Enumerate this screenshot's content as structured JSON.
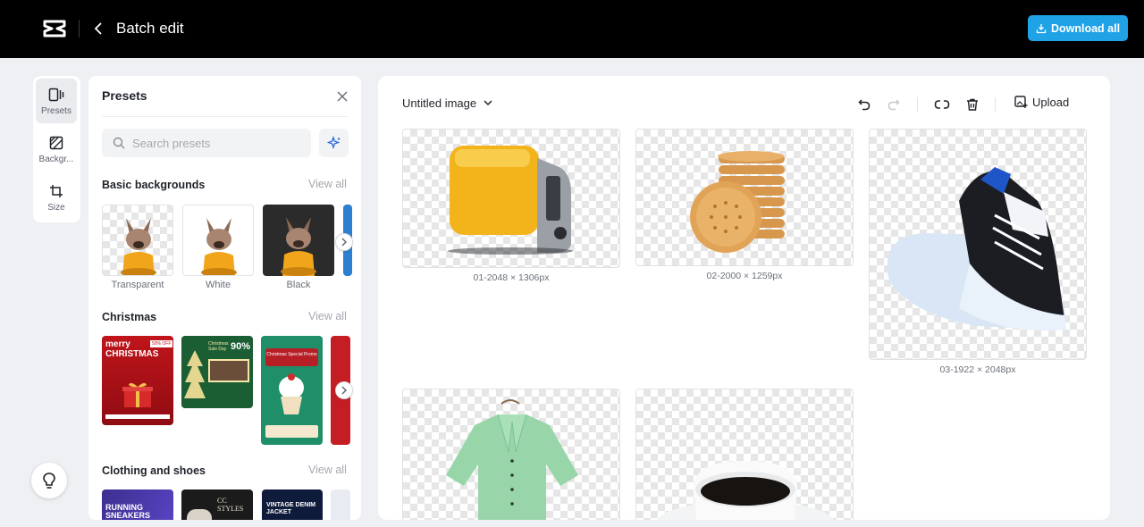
{
  "header": {
    "logo_icon": "capcut-logo",
    "back_icon": "chevron-left-icon",
    "title": "Batch edit",
    "download_label": "Download all",
    "download_color": "#1fa3e6"
  },
  "rail": {
    "items": [
      {
        "label": "Presets",
        "icon": "presets-icon",
        "active": true
      },
      {
        "label": "Backgr...",
        "icon": "background-icon",
        "active": false
      },
      {
        "label": "Size",
        "icon": "crop-icon",
        "active": false
      }
    ],
    "hint_icon": "lightbulb-icon"
  },
  "panel": {
    "title": "Presets",
    "search_placeholder": "Search presets",
    "sections": [
      {
        "title": "Basic backgrounds",
        "view_all": "View all",
        "items": [
          {
            "label": "Transparent"
          },
          {
            "label": "White"
          },
          {
            "label": "Black"
          }
        ]
      },
      {
        "title": "Christmas",
        "view_all": "View all",
        "items": [
          {
            "heading": "merry CHRISTMAS",
            "badge": "50% OFF"
          },
          {
            "heading": "Christmas Sale Day",
            "badge": "90%"
          },
          {
            "heading": "Christmas Special Promo"
          }
        ]
      },
      {
        "title": "Clothing and shoes",
        "view_all": "View all",
        "items": [
          {
            "heading": "RUNNING SNEAKERS"
          },
          {
            "heading": "CC STYLES"
          },
          {
            "heading": "VINTAGE DENIM JACKET"
          }
        ]
      }
    ]
  },
  "canvas": {
    "image_select": "Untitled image",
    "upload_label": "Upload",
    "images": [
      {
        "caption": "01-2048 × 1306px",
        "subject": "toaster"
      },
      {
        "caption": "02-2000 × 1259px",
        "subject": "crackers"
      },
      {
        "caption": "03-1922 × 2048px",
        "subject": "sneaker"
      },
      {
        "caption": "",
        "subject": "shirt"
      },
      {
        "caption": "",
        "subject": "coffee"
      }
    ]
  }
}
